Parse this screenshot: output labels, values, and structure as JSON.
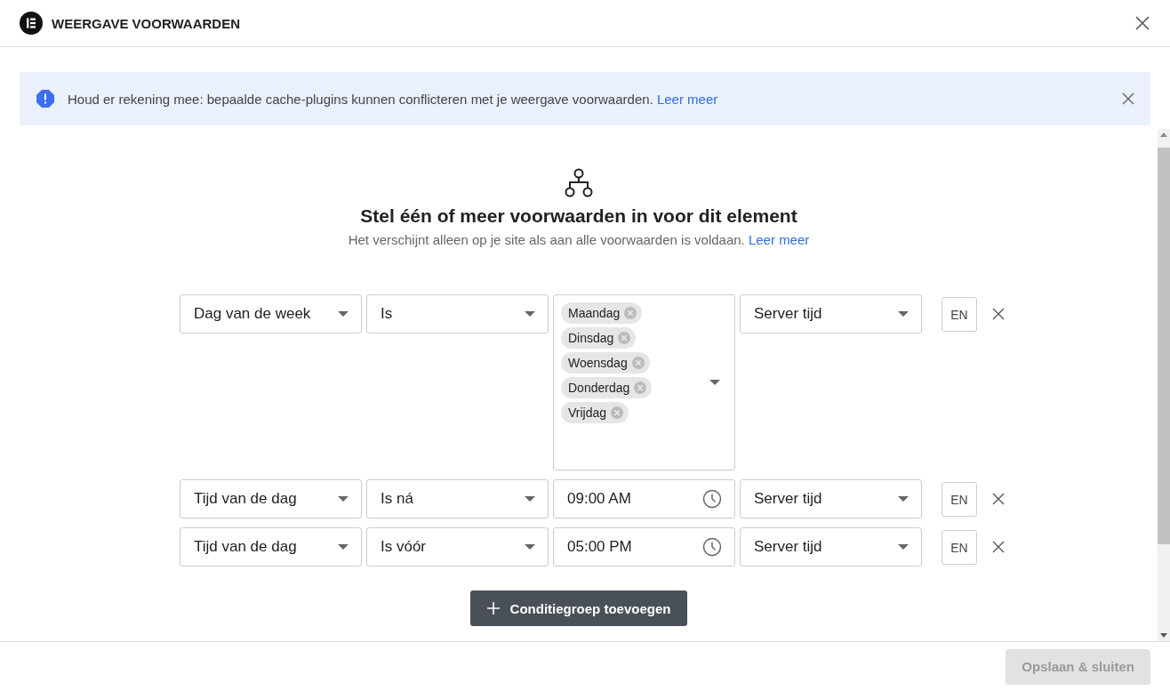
{
  "dialog": {
    "title": "WEERGAVE VOORWAARDEN"
  },
  "notice": {
    "text": "Houd er rekening mee: bepaalde cache-plugins kunnen conflicteren met je weergave voorwaarden.",
    "link": "Leer meer"
  },
  "intro": {
    "heading": "Stel één of meer voorwaarden in voor dit element",
    "text": "Het verschijnt alleen op je site als aan alle voorwaarden is voldaan.",
    "link": "Leer meer"
  },
  "conditions": [
    {
      "field": "Dag van de week",
      "operator": "Is",
      "value": {
        "kind": "tags",
        "tags": [
          "Maandag",
          "Dinsdag",
          "Woensdag",
          "Donderdag",
          "Vrijdag"
        ]
      },
      "timezone": "Server tijd",
      "connector": "EN"
    },
    {
      "field": "Tijd van de dag",
      "operator": "Is ná",
      "value": {
        "kind": "time",
        "time": "09:00 AM"
      },
      "timezone": "Server tijd",
      "connector": "EN"
    },
    {
      "field": "Tijd van de dag",
      "operator": "Is vóór",
      "value": {
        "kind": "time",
        "time": "05:00 PM"
      },
      "timezone": "Server tijd",
      "connector": "EN"
    }
  ],
  "add_button": {
    "label": "Conditiegroep toevoegen"
  },
  "save_button": {
    "label": "Opslaan & sluiten",
    "disabled": true
  }
}
